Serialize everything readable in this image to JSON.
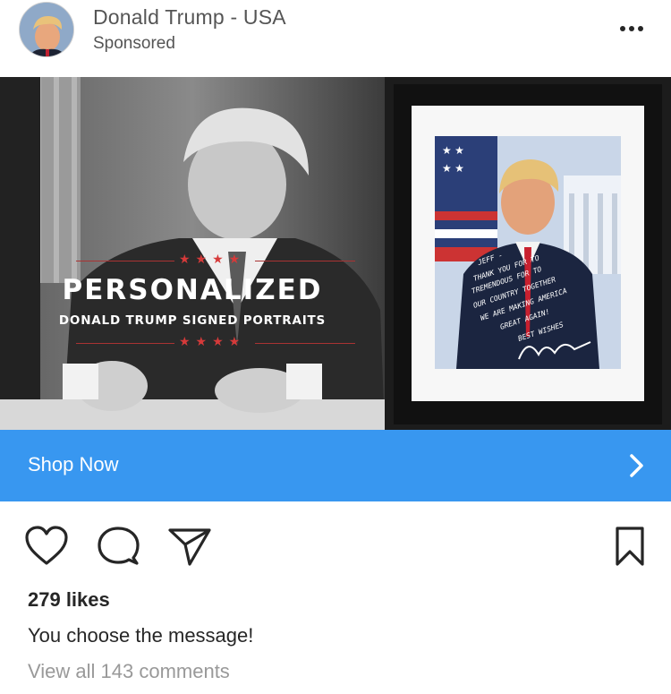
{
  "post": {
    "account_name": "Donald Trump - USA",
    "sponsored_label": "Sponsored",
    "more_icon": "more-horizontal-icon"
  },
  "media": {
    "headline": "PERSONALIZED",
    "subheadline": "DONALD TRUMP SIGNED PORTRAITS",
    "stars": "★★★★",
    "signed_note_lines": [
      "JEFF -",
      "THANK YOU FOR TO",
      "TREMENDOUS FOR TO",
      "OUR COUNTRY TOGETHER",
      "WE ARE MAKING AMERICA",
      "GREAT AGAIN!",
      "BEST WISHES"
    ]
  },
  "cta": {
    "label": "Shop Now",
    "icon": "chevron-right-icon",
    "color": "#3897f0"
  },
  "actions": {
    "like_icon": "heart-icon",
    "comment_icon": "comment-icon",
    "share_icon": "share-icon",
    "save_icon": "bookmark-icon"
  },
  "stats": {
    "likes": "279 likes",
    "caption": "You choose the message!",
    "view_comments": "View all 143 comments"
  }
}
